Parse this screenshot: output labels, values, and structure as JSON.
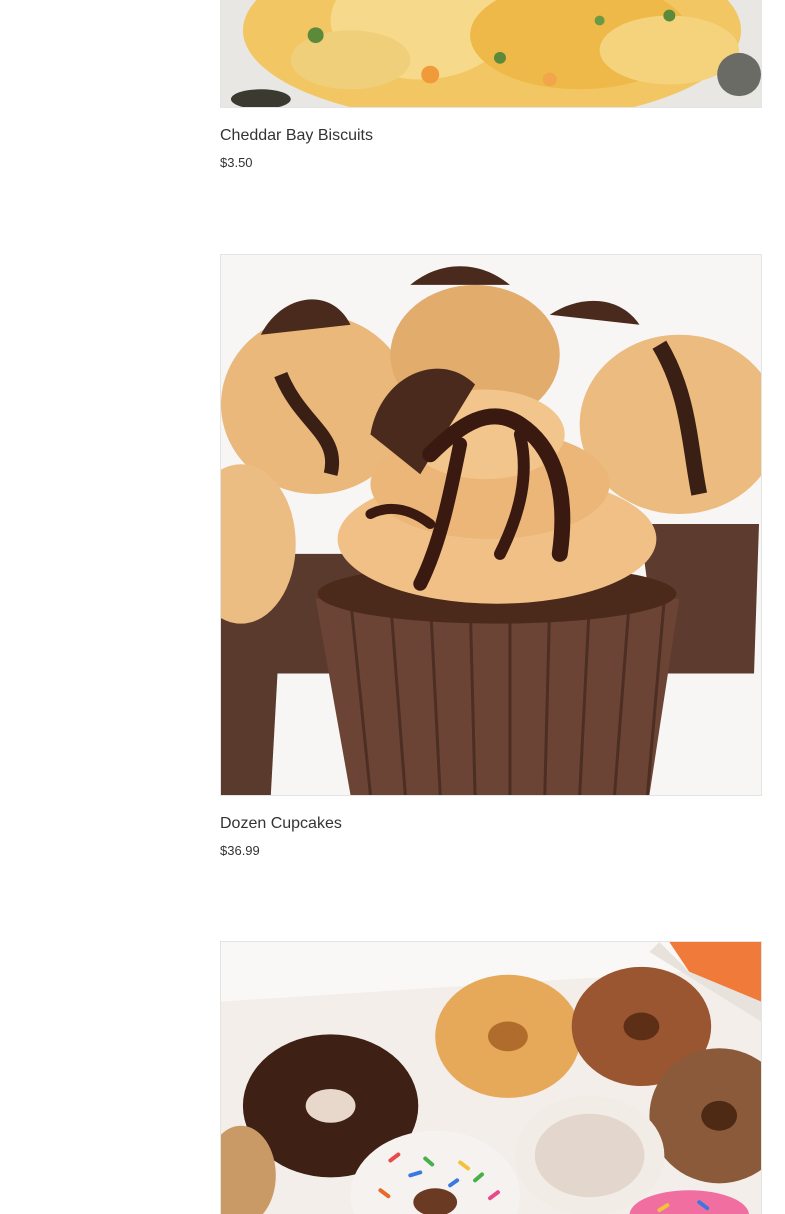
{
  "products": [
    {
      "name": "Cheddar Bay Biscuits",
      "price": "$3.50",
      "image_icon": "biscuit-photo"
    },
    {
      "name": "Dozen Cupcakes",
      "price": "$36.99",
      "image_icon": "cupcake-photo"
    },
    {
      "name": "",
      "price": "",
      "image_icon": "donut-box-photo"
    }
  ],
  "colors": {
    "text": "#333333",
    "border": "#e4e4e4",
    "background": "#ffffff"
  }
}
